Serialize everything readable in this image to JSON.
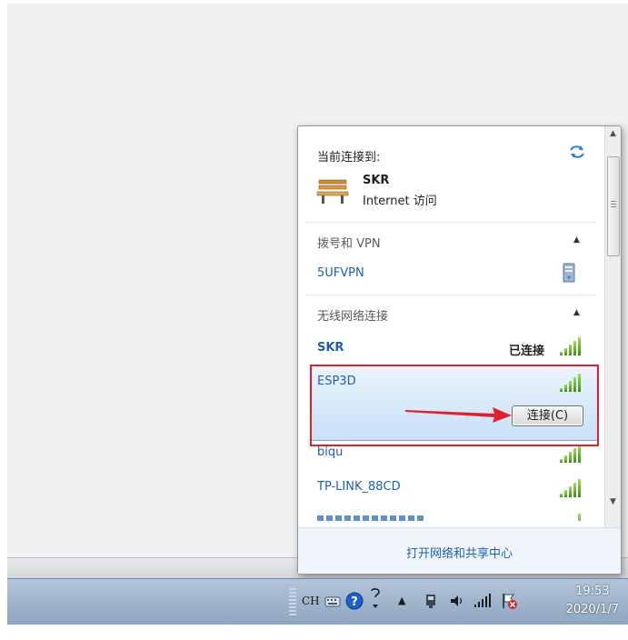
{
  "flyout": {
    "current_connection_label": "当前连接到:",
    "current_network": {
      "name": "SKR",
      "access": "Internet 访问"
    },
    "sections": [
      {
        "title": "拨号和 VPN",
        "items": [
          {
            "name": "5UFVPN"
          }
        ]
      },
      {
        "title": "无线网络连接",
        "items": [
          {
            "name": "SKR",
            "status": "已连接"
          },
          {
            "name": "ESP3D",
            "selected": true,
            "button": "连接(C)"
          },
          {
            "name": "biqu"
          },
          {
            "name": "TP-LINK_88CD"
          }
        ]
      }
    ],
    "footer_link": "打开网络和共享中心"
  },
  "taskbar": {
    "language": "CH",
    "time": "19:53",
    "date": "2020/1/7"
  },
  "icons": {
    "refresh": "refresh-arrows-icon",
    "network": "bench-network-icon",
    "vpn": "vpn-server-icon",
    "signal": "signal-strength-icon",
    "annotation": "red-arrow"
  },
  "colors": {
    "link_blue": "#1f5faa",
    "highlight_border": "#e0202a",
    "signal_green": "#4fa11c"
  }
}
